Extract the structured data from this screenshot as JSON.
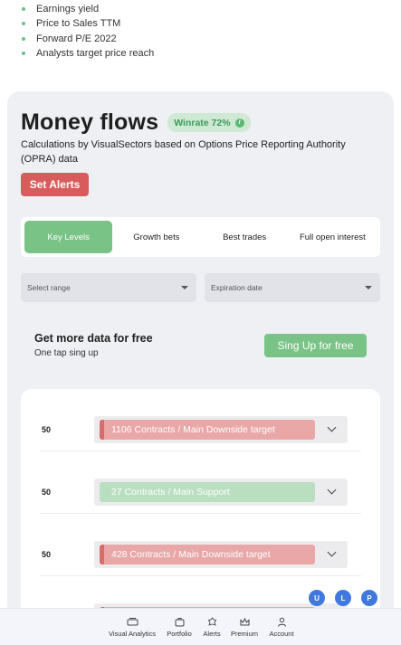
{
  "bullets": [
    "Earnings yield",
    "Price to Sales TTM",
    "Forward P/E 2022",
    "Analysts target price reach"
  ],
  "header": {
    "title": "Money flows",
    "winrate": "Winrate 72%",
    "subtitle": "Calculations by VisualSectors based on Options Price Reporting Authority (OPRA) data",
    "alerts_button": "Set Alerts"
  },
  "tabs": [
    {
      "label": "Key Levels",
      "active": true
    },
    {
      "label": "Growth bets",
      "active": false
    },
    {
      "label": "Best trades",
      "active": false
    },
    {
      "label": "Full open interest",
      "active": false
    }
  ],
  "filters": {
    "range_placeholder": "Select range",
    "expiration_placeholder": "Expiration date"
  },
  "promo": {
    "title": "Get more data for free",
    "subtitle": "One tap sing up",
    "button": "Sing Up for free"
  },
  "levels": [
    {
      "value": "50",
      "label": "1106 Contracts / Main Downside target",
      "kind": "downside"
    },
    {
      "value": "50",
      "label": "27 Contracts / Main Support",
      "kind": "support"
    },
    {
      "value": "50",
      "label": "428 Contracts / Main Downside target",
      "kind": "downside"
    }
  ],
  "bubbles": [
    "U",
    "L",
    "P"
  ],
  "nav": [
    {
      "label": "Visual Analytics",
      "icon": "analytics-icon"
    },
    {
      "label": "Portfolio",
      "icon": "portfolio-icon"
    },
    {
      "label": "Alerts",
      "icon": "alerts-icon"
    },
    {
      "label": "Premium",
      "icon": "crown-icon"
    },
    {
      "label": "Account",
      "icon": "account-icon"
    }
  ],
  "colors": {
    "accent_green": "#79c386",
    "alert_red": "#d95c5c",
    "downside_bar": "#e9a7a7",
    "support_bar": "#b9dfc0",
    "bubble_blue": "#3f79de"
  }
}
